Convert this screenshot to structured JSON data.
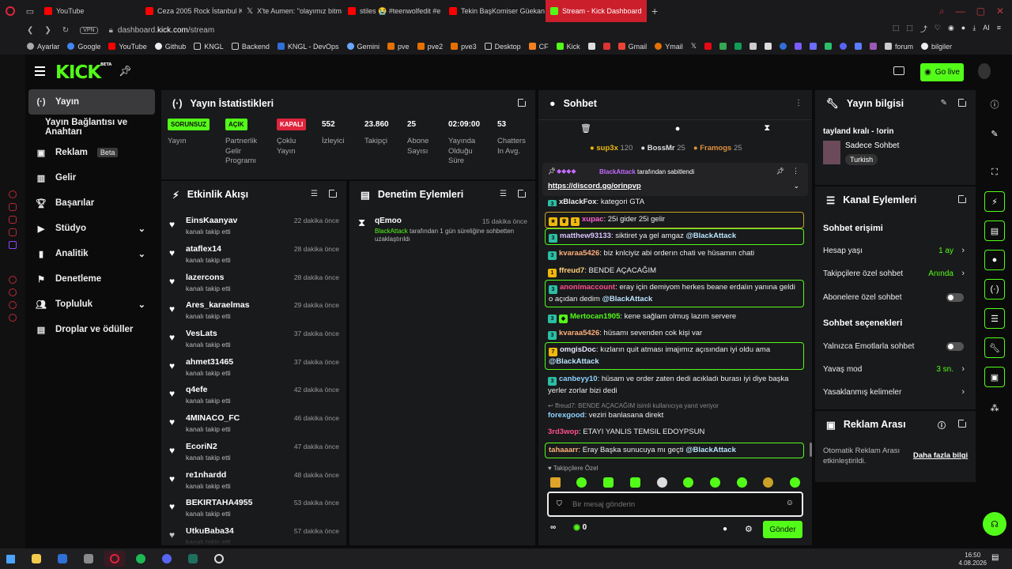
{
  "browser": {
    "tabs": [
      {
        "label": "YouTube",
        "icon": "youtube"
      },
      {
        "label": "Ceza 2005 Rock İstanbul K",
        "icon": "youtube"
      },
      {
        "label": "X'te Aumen: \"olayımız bitm",
        "icon": "x"
      },
      {
        "label": "stiles 😭 #teenwolfedit #e",
        "icon": "youtube"
      },
      {
        "label": "Tekin BaşKomiser Güekan",
        "icon": "youtube"
      },
      {
        "label": "Stream - Kick Dashboard",
        "icon": "kick",
        "active": true
      }
    ],
    "url_prefix": "dashboard.",
    "url_host": "kick.com",
    "url_path": "/stream",
    "vpn": "VPN",
    "ai": "AI",
    "bookmarks": [
      "Ayarlar",
      "Google",
      "YouTube",
      "Github",
      "KNGL",
      "Backend",
      "KNGL - DevOps",
      "Gemini",
      "pve",
      "pve2",
      "pve3",
      "Desktop",
      "CF",
      "Kick",
      "Gmail",
      "Ymail",
      "forum",
      "bilgiler"
    ]
  },
  "header": {
    "logo": "KICK",
    "logo_sup": "BETA",
    "go_live": "Go live",
    "colors": {
      "brand": "#53fc18",
      "danger": "#e0243c"
    }
  },
  "nav": {
    "items": [
      {
        "label": "Yayın",
        "icon": "broadcast-icon",
        "active": true
      },
      {
        "label": "Yayın Bağlantısı ve Anahtarı",
        "sub": true
      },
      {
        "label": "Reklam",
        "icon": "ad-icon",
        "badge": "Beta"
      },
      {
        "label": "Gelir",
        "icon": "revenue-icon"
      },
      {
        "label": "Başarılar",
        "icon": "trophy-icon"
      },
      {
        "label": "Stüdyo",
        "icon": "studio-icon",
        "chevron": true
      },
      {
        "label": "Analitik",
        "icon": "analytics-icon",
        "chevron": true
      },
      {
        "label": "Denetleme",
        "icon": "moderation-icon"
      },
      {
        "label": "Topluluk",
        "icon": "community-icon",
        "chevron": true
      },
      {
        "label": "Droplar ve ödüller",
        "icon": "drops-icon"
      }
    ]
  },
  "stats": {
    "title": "Yayın İstatistikleri",
    "items": [
      {
        "value": "SORUNSUZ",
        "label": "Yayın",
        "chip": "green"
      },
      {
        "value": "AÇIK",
        "label": "Partnerlik Gelir Programı",
        "chip": "green"
      },
      {
        "value": "KAPALI",
        "label": "Çoklu Yayın",
        "chip": "red"
      },
      {
        "value": "552",
        "label": "İzleyici"
      },
      {
        "value": "23.860",
        "label": "Takipçi"
      },
      {
        "value": "25",
        "label": "Abone Sayısı"
      },
      {
        "value": "02:09:00",
        "label": "Yayında Olduğu Süre"
      },
      {
        "value": "53",
        "label": "Chatters In Avg."
      }
    ]
  },
  "activity": {
    "title": "Etkinlik Akışı",
    "subtitle": "kanalı takip etti",
    "items": [
      {
        "name": "EinsKaanyav",
        "time": "22 dakika önce"
      },
      {
        "name": "ataflex14",
        "time": "28 dakika önce"
      },
      {
        "name": "lazercons",
        "time": "28 dakika önce"
      },
      {
        "name": "Ares_karaelmas",
        "time": "29 dakika önce"
      },
      {
        "name": "VesLats",
        "time": "37 dakika önce"
      },
      {
        "name": "ahmet31465",
        "time": "37 dakika önce"
      },
      {
        "name": "q4efe",
        "time": "42 dakika önce"
      },
      {
        "name": "4MINACO_FC",
        "time": "46 dakika önce"
      },
      {
        "name": "EcoriN2",
        "time": "47 dakika önce"
      },
      {
        "name": "re1nhardd",
        "time": "48 dakika önce"
      },
      {
        "name": "BEKIRTAHA4955",
        "time": "53 dakika önce"
      },
      {
        "name": "UtkuBaba34",
        "time": "57 dakika önce"
      }
    ]
  },
  "moderation": {
    "title": "Denetim Eylemleri",
    "user": "qEmoo",
    "time": "15 dakika önce",
    "actor": "BlackAttack",
    "text": "tarafından 1 gün süreliğine sohbetten uzaklaştırıldı"
  },
  "chat": {
    "title": "Sohbet",
    "leaders": [
      {
        "name": "sup3x",
        "count": "120"
      },
      {
        "name": "BossMr",
        "count": "25"
      },
      {
        "name": "Framogs",
        "count": "25"
      }
    ],
    "pinned_by": "BlackAttack",
    "pinned_suffix": "tarafından sabitlendi",
    "pinned_link": "https://discord.gg/orinpvp",
    "messages": [
      {
        "user": "xBlackFox",
        "text": "kategori GTA"
      },
      {
        "user": "xupac",
        "text": "25i gider 25i gelir"
      },
      {
        "user": "matthew93133",
        "text": "siktiret ya gel amgaz",
        "mention": "@BlackAttack"
      },
      {
        "user": "kvaraa5426",
        "text": "biz knlciyiz abi orderın chati ve hüsamın chati"
      },
      {
        "user": "ffreud7",
        "text": "BENDE AÇACAĞIM"
      },
      {
        "user": "anonimaccount",
        "text": "eray için demiyom herkes beane erdalın yanına geldi o açıdan dedim",
        "mention": "@BlackAttack"
      },
      {
        "user": "Mertocan1905",
        "text": "kene sağlam olmuş lazım servere"
      },
      {
        "user": "kvaraa5426",
        "text": "hüsamı sevenden cok kişi var"
      },
      {
        "user": "omgisDoc",
        "text": "kızların quit atması imajımız açısından iyi oldu ama",
        "mention": "@BlackAttack"
      },
      {
        "user": "canbeyy10",
        "text": "hüsam ve order zaten dedi acıkladı burası iyi diye başka yerler zorlar bizi dedi"
      },
      {
        "reply": "ffreud7: BENDE AÇACAĞIM isimli kullanıcıya yanıt veriyor"
      },
      {
        "user": "forexgood",
        "text": "veziri banlasana direkt"
      },
      {
        "user": "3rd3wop",
        "text": "ETAYI YANLIS TEMSIL EDOYPSUN"
      },
      {
        "user": "tahaaarr",
        "text": "Eray Başka sunucuya mı geçti",
        "mention": "@BlackAttack"
      }
    ],
    "followers_only": "Takipçilere Özel",
    "input_placeholder": "Bir mesaj gönderin",
    "send": "Gönder",
    "points": "0"
  },
  "stream_info": {
    "title": "Yayın bilgisi",
    "stream_title": "tayland kralı - !orin",
    "category": "Sadece Sohbet",
    "tag": "Turkish"
  },
  "channel_actions": {
    "title": "Kanal Eylemleri",
    "access_title": "Sohbet erişimi",
    "access": [
      {
        "label": "Hesap yaşı",
        "value": "1 ay"
      },
      {
        "label": "Takipçilere özel sohbet",
        "value": "Anında"
      },
      {
        "label": "Abonelere özel sohbet",
        "toggle": "off"
      }
    ],
    "options_title": "Sohbet seçenekleri",
    "options": [
      {
        "label": "Yalnızca Emotlarla sohbet",
        "toggle": "off"
      },
      {
        "label": "Yavaş mod",
        "value": "3 sn."
      },
      {
        "label": "Yasaklanmış kelimeler"
      }
    ]
  },
  "ads": {
    "title": "Reklam Arası",
    "text": "Otomatik Reklam Arası etkinleştirildi.",
    "link": "Daha fazla bilgi"
  },
  "taskbar": {
    "time": "16:50",
    "date": "4.08.2026"
  }
}
